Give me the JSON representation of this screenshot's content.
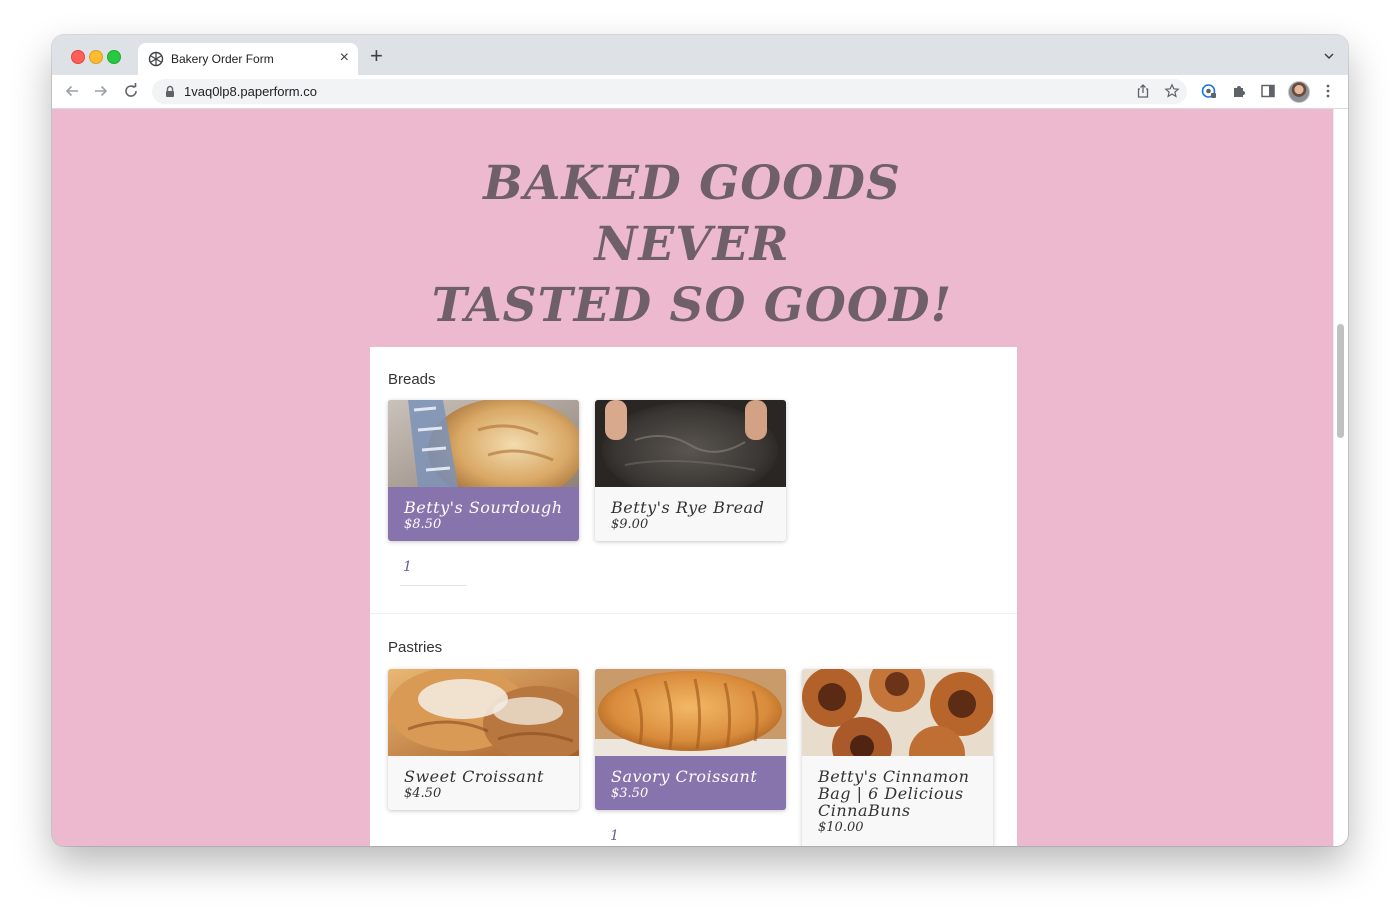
{
  "browser": {
    "tab_title": "Bakery Order Form",
    "url": "1vaq0lp8.paperform.co"
  },
  "page": {
    "hero_line1": "BAKED GOODS NEVER",
    "hero_line2": "TASTED SO GOOD!",
    "sections": [
      {
        "title": "Breads",
        "products": [
          {
            "name": "Betty's Sourdough",
            "price": "$8.50",
            "selected": true,
            "quantity": "1"
          },
          {
            "name": "Betty's Rye Bread",
            "price": "$9.00",
            "selected": false
          }
        ]
      },
      {
        "title": "Pastries",
        "products": [
          {
            "name": "Sweet Croissant",
            "price": "$4.50",
            "selected": false
          },
          {
            "name": "Savory Croissant",
            "price": "$3.50",
            "selected": true,
            "quantity": "1"
          },
          {
            "name": "Betty's Cinnamon Bag | 6 Delicious CinnaBuns",
            "price": "$10.00",
            "selected": false
          }
        ]
      }
    ]
  },
  "colors": {
    "page_background": "#edb9cf",
    "hero_text": "#6f5f69",
    "selected_card": "#8874ac",
    "quantity_text": "#6b5a9c"
  },
  "icons": [
    "paperform-favicon-icon",
    "close-icon",
    "plus-icon",
    "chevron-down-icon",
    "back-arrow-icon",
    "forward-arrow-icon",
    "reload-icon",
    "lock-icon",
    "share-icon",
    "star-icon",
    "google-lens-icon",
    "extensions-icon",
    "side-panel-icon",
    "profile-avatar",
    "more-menu-icon"
  ]
}
